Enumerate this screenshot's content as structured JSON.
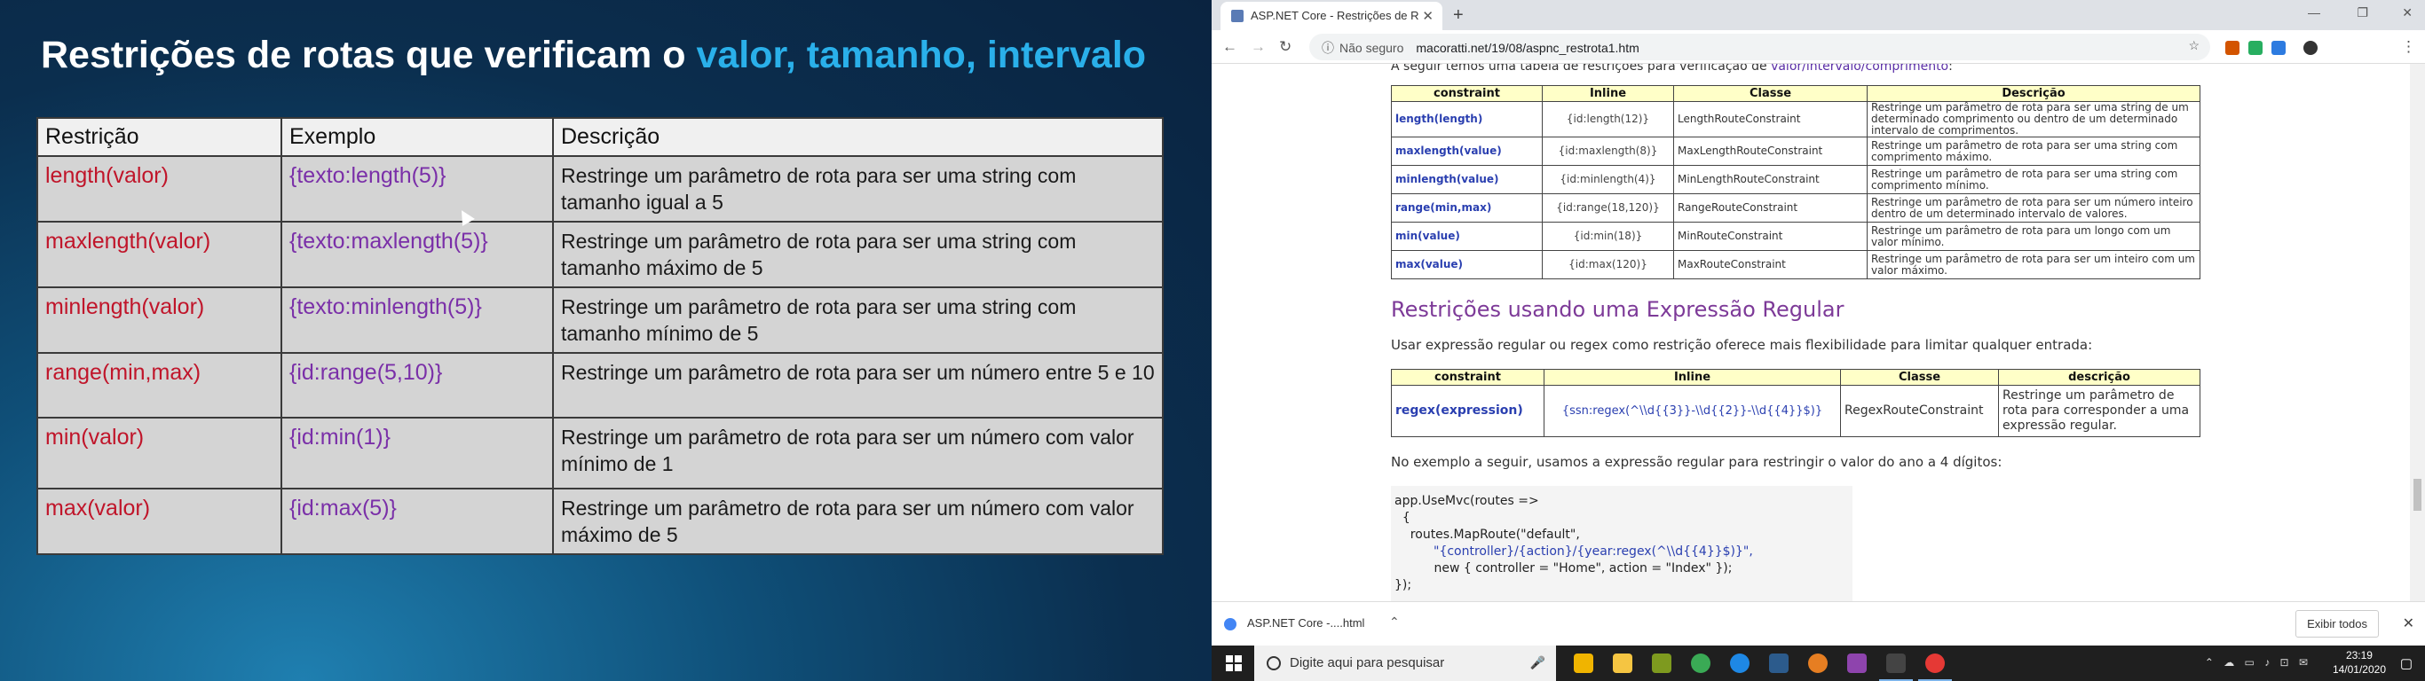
{
  "slide": {
    "title_prefix": "Restrições de rotas que  verificam o ",
    "title_highlight": "valor, tamanho, intervalo",
    "headers": [
      "Restrição",
      "Exemplo",
      "Descrição"
    ],
    "rows": [
      {
        "c": "length(valor)",
        "e": "{texto:length(5)}",
        "d": "Restringe um parâmetro de rota para ser uma string com tamanho igual a 5"
      },
      {
        "c": "maxlength(valor)",
        "e": "{texto:maxlength(5)}",
        "d": "Restringe um parâmetro de rota para ser uma string com tamanho máximo de 5"
      },
      {
        "c": "minlength(valor)",
        "e": "{texto:minlength(5)}",
        "d": "Restringe um parâmetro de rota para ser uma string com tamanho mínimo de 5"
      },
      {
        "c": "range(min,max)",
        "e": "{id:range(5,10)}",
        "d": "Restringe um parâmetro de rota para ser um número entre 5 e 10"
      },
      {
        "c": "min(valor)",
        "e": "{id:min(1)}",
        "d": "Restringe um parâmetro de rota para ser um  número com valor mínimo de 1"
      },
      {
        "c": "max(valor)",
        "e": "{id:max(5)}",
        "d": "Restringe um parâmetro de rota para ser um número com valor máximo de 5"
      }
    ]
  },
  "browser": {
    "tab_title": "ASP.NET Core  -  Restrições de R",
    "security": "Não seguro",
    "url": "macoratti.net/19/08/aspnc_restrota1.htm",
    "intro_text": "A seguir temos uma tabela de restrições para verificação de ",
    "intro_link": "valor/intervalo/comprimento",
    "intro_end": ":",
    "table1": {
      "headers": [
        "constraint",
        "Inline",
        "Classe",
        "Descrição"
      ],
      "rows": [
        {
          "k": "length(length)",
          "i": "{id:length(12)}",
          "c": "LengthRouteConstraint",
          "d": "Restringe um parâmetro de rota para ser uma string de um determinado comprimento ou dentro de um determinado intervalo de comprimentos."
        },
        {
          "k": "maxlength(value)",
          "i": "{id:maxlength(8)}",
          "c": "MaxLengthRouteConstraint",
          "d": "Restringe um parâmetro de rota para ser uma string com comprimento máximo."
        },
        {
          "k": "minlength(value)",
          "i": "{id:minlength(4)}",
          "c": "MinLengthRouteConstraint",
          "d": "Restringe um parâmetro de rota para ser uma string com comprimento mínimo."
        },
        {
          "k": "range(min,max)",
          "i": "{id:range(18,120)}",
          "c": "RangeRouteConstraint",
          "d": "Restringe um parâmetro de rota para ser um número inteiro dentro de um determinado intervalo de valores."
        },
        {
          "k": "min(value)",
          "i": "{id:min(18)}",
          "c": "MinRouteConstraint",
          "d": "Restringe um parâmetro de rota para um longo com um valor mínimo."
        },
        {
          "k": "max(value)",
          "i": "{id:max(120)}",
          "c": "MaxRouteConstraint",
          "d": "Restringe um parâmetro de rota para ser um inteiro com um valor máximo."
        }
      ]
    },
    "heading2": "Restrições usando uma Expressão Regular",
    "para1": "Usar expressão regular ou regex como restrição oferece mais flexibilidade para limitar qualquer entrada:",
    "table2": {
      "headers": [
        "constraint",
        "Inline",
        "Classe",
        "descrição"
      ],
      "row": {
        "k": "regex(expression)",
        "i": "{ssn:regex(^\\\\d{{3}}-\\\\d{{2}}-\\\\d{{4}}$)}",
        "c": "RegexRouteConstraint",
        "d": "Restringe um parâmetro de rota para corresponder a uma expressão regular."
      }
    },
    "para2": "No exemplo a seguir, usamos a expressão regular para restringir o valor do ano a 4 dígitos:",
    "code": {
      "l1": "app.UseMvc(routes =>",
      "l2": "  {",
      "l3": "    routes.MapRoute(\"default\",",
      "l4": "\"{controller}/{action}/{year:regex(^\\\\d{{4}}$)}\",",
      "l5": "          new { controller = \"Home\", action = \"Index\" });",
      "l6": "});"
    },
    "download_file": "ASP.NET Core  -....html",
    "download_all": "Exibir todos"
  },
  "taskbar": {
    "search_placeholder": "Digite aqui para pesquisar",
    "time": "23:19",
    "date": "14/01/2020"
  }
}
